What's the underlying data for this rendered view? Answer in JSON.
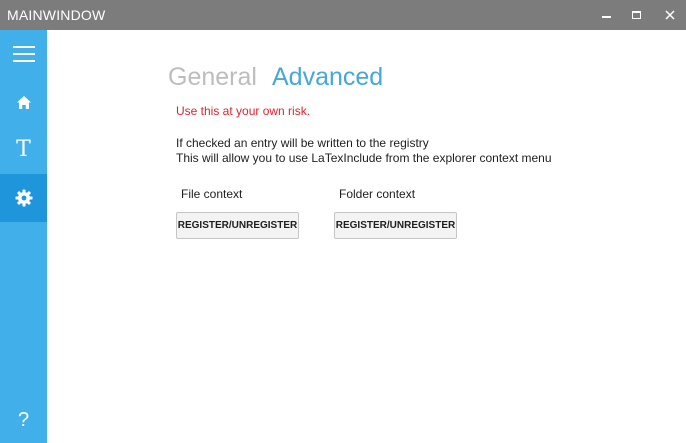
{
  "window": {
    "title": "MAINWINDOW",
    "controls": {
      "minimize": "minimize-icon",
      "maximize": "maximize-icon",
      "close": "close-icon"
    }
  },
  "sidebar": {
    "items": [
      {
        "icon": "hamburger-menu-icon"
      },
      {
        "icon": "home-icon"
      },
      {
        "icon": "text-icon",
        "glyph": "T"
      },
      {
        "icon": "settings-gear-icon",
        "selected": true
      },
      {
        "icon": "help-icon",
        "glyph": "?"
      }
    ]
  },
  "tabs": [
    {
      "label": "General",
      "active": false
    },
    {
      "label": "Advanced",
      "active": true
    }
  ],
  "content": {
    "warning": "Use this at your own risk.",
    "description_line1": "If checked an entry will be written to the registry",
    "description_line2": "This will allow you to use LaTexInclude from the explorer context menu",
    "file_context_label": "File context",
    "folder_context_label": "Folder context",
    "file_button_label": "REGISTER/UNREGISTER",
    "folder_button_label": "REGISTER/UNREGISTER"
  },
  "colors": {
    "titlebar": "#7c7c7c",
    "sidebar": "#41b0ea",
    "sidebar_selected": "#1f95db",
    "accent": "#45a7dc",
    "warning": "#e0222f",
    "inactive_tab": "#bdbdbd"
  }
}
